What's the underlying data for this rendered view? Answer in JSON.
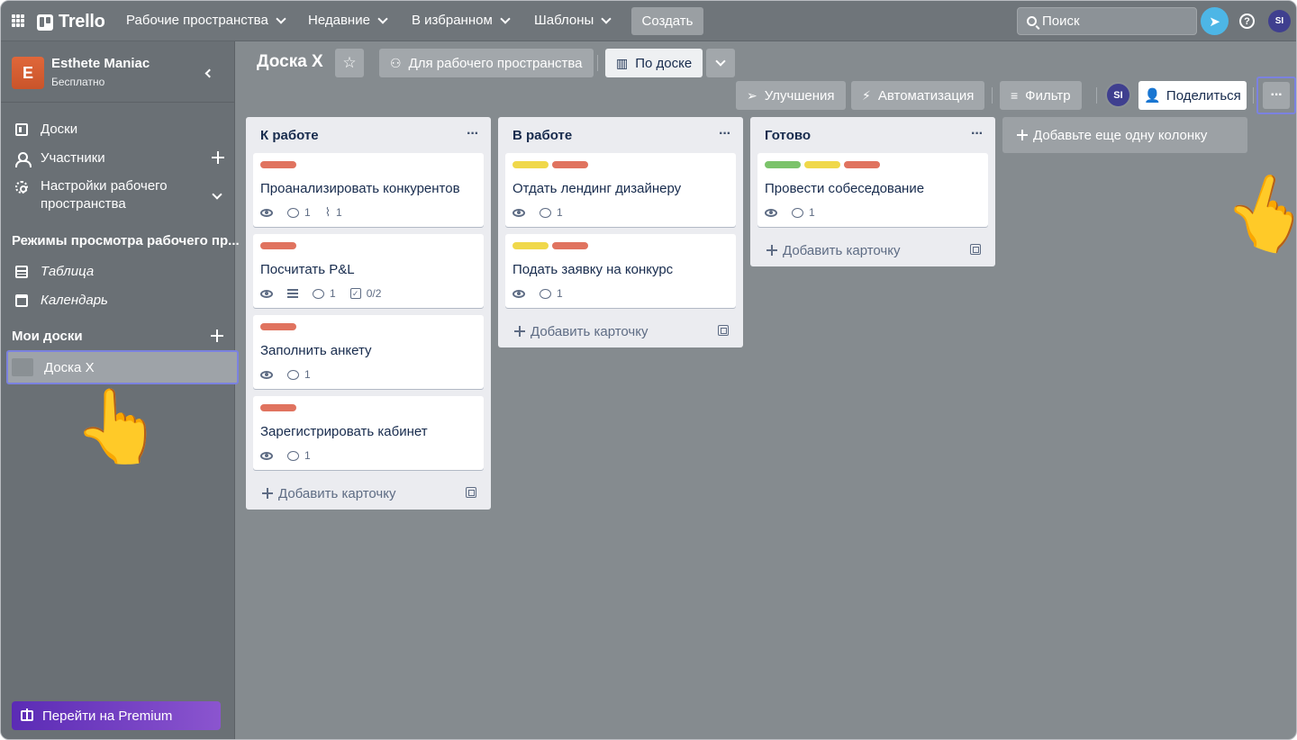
{
  "topbar": {
    "logo": "Trello",
    "nav": [
      {
        "label": "Рабочие пространства"
      },
      {
        "label": "Недавние"
      },
      {
        "label": "В избранном"
      },
      {
        "label": "Шаблоны"
      }
    ],
    "create_label": "Создать",
    "search_placeholder": "Поиск",
    "avatar_initials": "SI"
  },
  "sidebar": {
    "workspace_initial": "E",
    "workspace_name": "Esthete Maniac",
    "workspace_plan": "Бесплатно",
    "items": [
      {
        "label": "Доски",
        "icon": "board-icon"
      },
      {
        "label": "Участники",
        "icon": "members-icon"
      },
      {
        "label": "Настройки рабочего\nпространства",
        "icon": "gear-icon"
      }
    ],
    "views_heading": "Режимы просмотра рабочего пр...",
    "views": [
      {
        "label": "Таблица",
        "icon": "table-icon"
      },
      {
        "label": "Календарь",
        "icon": "calendar-icon"
      }
    ],
    "my_boards_heading": "Мои доски",
    "boards": [
      {
        "label": "Доска X"
      }
    ],
    "premium_label": "Перейти на Premium"
  },
  "board": {
    "title": "Доска X",
    "visibility_label": "Для рабочего пространства",
    "view_label": "По доске",
    "powerups_label": "Улучшения",
    "automation_label": "Автоматизация",
    "filter_label": "Фильтр",
    "member_initials": "SI",
    "share_label": "Поделиться",
    "add_list_label": "Добавьте еще одну колонку",
    "add_card_label": "Добавить карточку"
  },
  "colors": {
    "label_red": "#e0735f",
    "label_yellow": "#f0d84a",
    "label_green": "#7bc36a",
    "accent": "#7b82e0"
  },
  "lists": [
    {
      "title": "К работе",
      "cards": [
        {
          "title": "Проанализировать конкурентов",
          "labels": [
            "red"
          ],
          "comments": "1",
          "attachments": "1"
        },
        {
          "title": "Посчитать P&L",
          "labels": [
            "red"
          ],
          "description": true,
          "comments": "1",
          "checklist": "0/2"
        },
        {
          "title": "Заполнить анкету",
          "labels": [
            "red"
          ],
          "comments": "1"
        },
        {
          "title": "Зарегистрировать кабинет",
          "labels": [
            "red"
          ],
          "comments": "1"
        }
      ]
    },
    {
      "title": "В работе",
      "cards": [
        {
          "title": "Отдать лендинг дизайнеру",
          "labels": [
            "yellow",
            "red"
          ],
          "comments": "1"
        },
        {
          "title": "Подать заявку на конкурс",
          "labels": [
            "yellow",
            "red"
          ],
          "comments": "1"
        }
      ]
    },
    {
      "title": "Готово",
      "cards": [
        {
          "title": "Провести собеседование",
          "labels": [
            "green",
            "yellow",
            "red"
          ],
          "comments": "1"
        }
      ]
    }
  ]
}
